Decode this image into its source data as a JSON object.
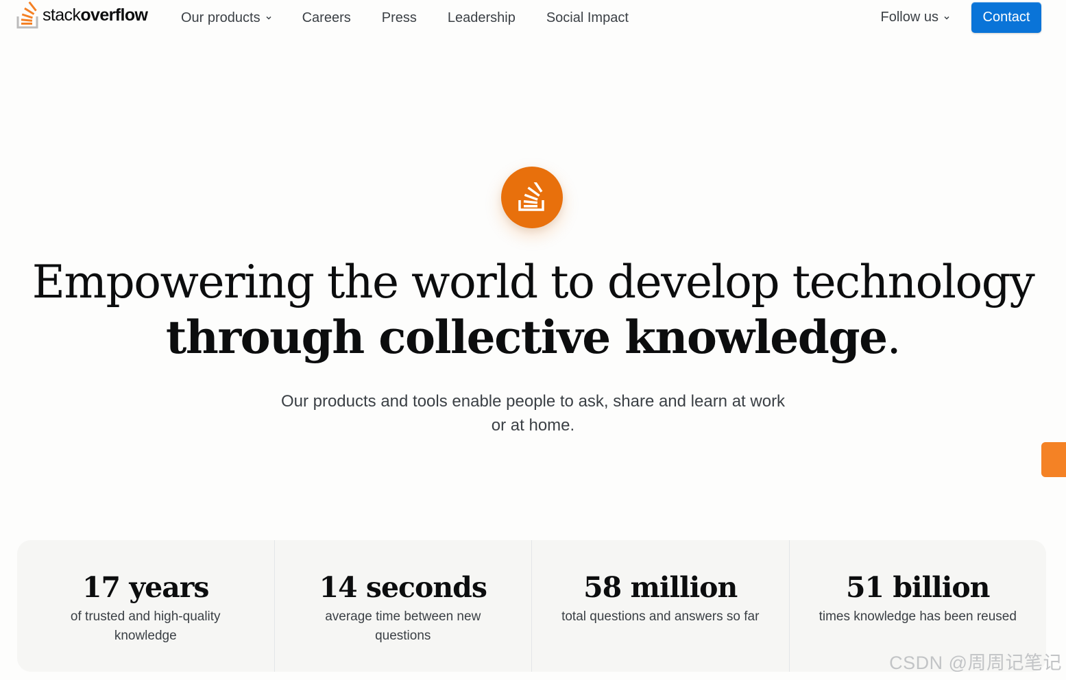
{
  "nav": {
    "logo": {
      "text_light": "stack",
      "text_bold": "overflow"
    },
    "links": [
      {
        "label": "Our products",
        "has_dropdown": true
      },
      {
        "label": "Careers",
        "has_dropdown": false
      },
      {
        "label": "Press",
        "has_dropdown": false
      },
      {
        "label": "Leadership",
        "has_dropdown": false
      },
      {
        "label": "Social Impact",
        "has_dropdown": false
      }
    ],
    "follow_label": "Follow us",
    "contact_label": "Contact"
  },
  "hero": {
    "icon": "stackoverflow-logo-icon",
    "headline_line1": "Empowering the world to develop technology",
    "headline_line2_bold": "through collective knowledge",
    "headline_line2_end": ".",
    "subtitle": "Our products and tools enable people to ask, share and learn at work or at home."
  },
  "stats": [
    {
      "value": "17 years",
      "label": "of trusted and high-quality knowledge"
    },
    {
      "value": "14 seconds",
      "label": "average time between new questions"
    },
    {
      "value": "58 million",
      "label": "total questions and answers so far"
    },
    {
      "value": "51 billion",
      "label": "times knowledge has been reused"
    }
  ],
  "watermark": "CSDN @周周记笔记",
  "colors": {
    "accent": "#f48225",
    "icon_bg": "#e8700c",
    "button": "#0a74d8",
    "text": "#0c0d0e"
  }
}
